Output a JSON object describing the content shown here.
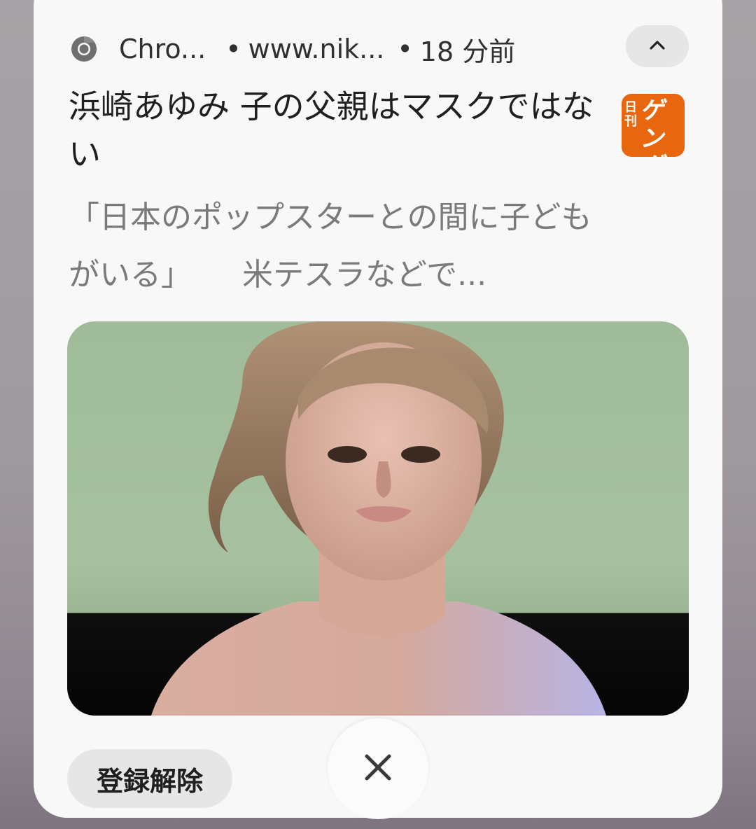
{
  "notification": {
    "app_name": "Chro...",
    "source_url": "www.nik...",
    "separator": "•",
    "time_ago": "18 分前",
    "title": "浜崎あゆみ 子の父親はマスクではない",
    "summary_part1": "「日本のポップスターとの間に子どもがいる」",
    "summary_part2": "米テスラなどで...",
    "brand_logo": {
      "small_text": "日刊",
      "big_text": "ゲンダイ",
      "color": "#e8660e"
    },
    "unsubscribe_label": "登録解除"
  },
  "icons": {
    "app": "chrome-icon",
    "expand": "chevron-up-icon",
    "dismiss": "close-icon"
  }
}
